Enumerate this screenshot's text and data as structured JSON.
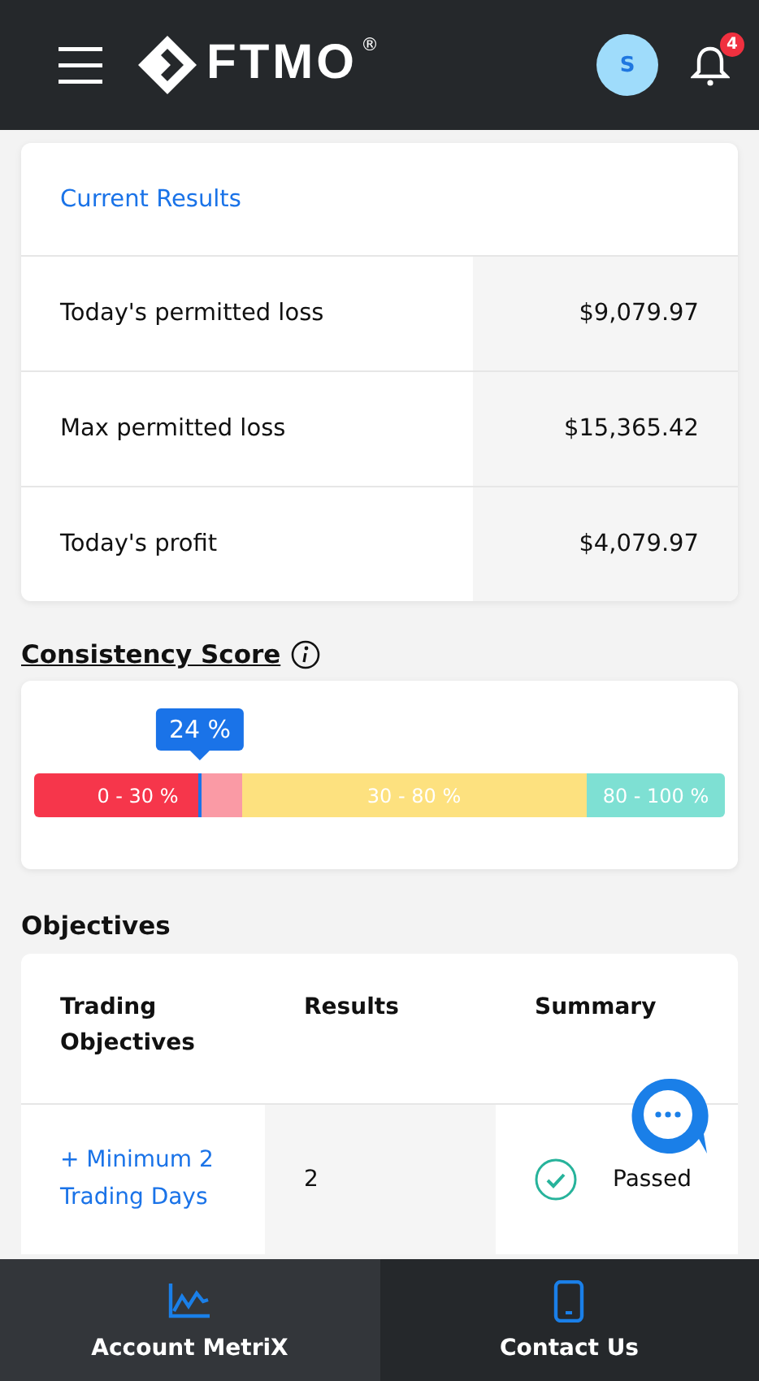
{
  "header": {
    "logo": "FTMO",
    "registered": "®",
    "avatar": "S",
    "notifications": "4"
  },
  "current_results": {
    "title": "Current Results",
    "rows": [
      {
        "label": "Today's permitted loss",
        "value": "$9,079.97"
      },
      {
        "label": "Max permitted loss",
        "value": "$15,365.42"
      },
      {
        "label": "Today's profit",
        "value": "$4,079.97"
      }
    ]
  },
  "consistency": {
    "title": "Consistency Score",
    "score_label": "24 %",
    "level": 0.24,
    "ranges": [
      {
        "label": "0 - 30 %",
        "color": "#f6364b"
      },
      {
        "label": "30 - 80 %",
        "color": "#fde17f"
      },
      {
        "label": "80 - 100 %",
        "color": "#7ee0d3"
      }
    ]
  },
  "objectives": {
    "title": "Objectives",
    "columns": [
      "Trading Objectives",
      "Results",
      "Summary"
    ],
    "rows": [
      {
        "objective": "+ Minimum 2 Trading Days",
        "result": "2",
        "summary": "Passed",
        "passed": true
      }
    ]
  },
  "nav": [
    {
      "kind": "chart",
      "label": "Account MetriX",
      "selected": true
    },
    {
      "kind": "phone",
      "label": "Contact Us",
      "selected": false
    }
  ]
}
